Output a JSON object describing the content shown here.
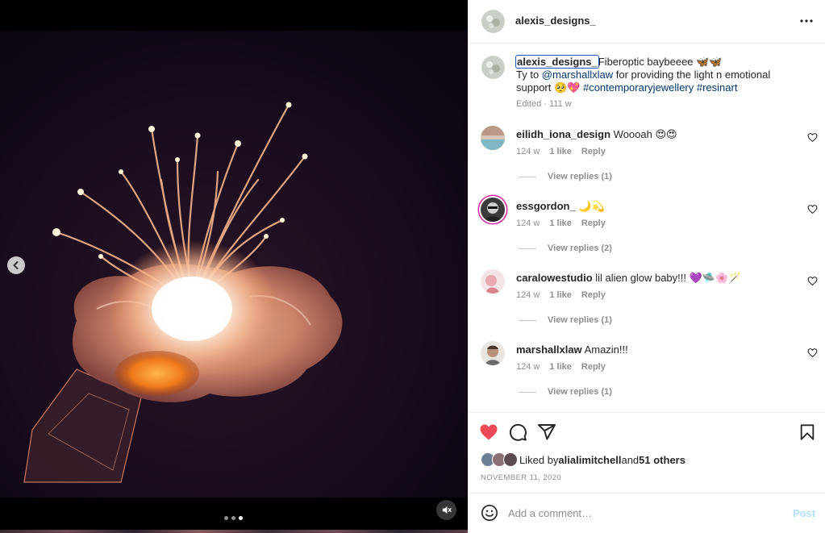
{
  "post": {
    "author": "alexis_designs_",
    "more_icon": "more-horizontal-icon",
    "caption": {
      "author": "alexis_designs_",
      "text_start": "Fiberoptic baybeeee 🦋🦋",
      "text_ty": "Ty to ",
      "mention": "@marshallxlaw",
      "text_mid": " for providing the light n emotional support 🥺💖 ",
      "hashtag1": "#contemporaryjewellery",
      "hashtag2": "#resinart",
      "meta": "Edited · 111 w"
    },
    "comments": [
      {
        "user": "eilidh_iona_design",
        "text": "Woooah 😍😍",
        "age": "124 w",
        "likes": "1 like",
        "reply": "Reply",
        "view_replies": "View replies (1)"
      },
      {
        "user": "essgordon_",
        "text": "🌙💫",
        "age": "124 w",
        "likes": "1 like",
        "reply": "Reply",
        "view_replies": "View replies (2)"
      },
      {
        "user": "caralowestudio",
        "text": "lil alien glow baby!!! 💜🛸🌸🪄",
        "age": "124 w",
        "likes": "1 like",
        "reply": "Reply",
        "view_replies": "View replies (1)"
      },
      {
        "user": "marshallxlaw",
        "text": "Amazin!!!",
        "age": "124 w",
        "likes": "1 like",
        "reply": "Reply",
        "view_replies": "View replies (1)"
      }
    ],
    "liked_by": {
      "prefix": "Liked by ",
      "user": "alialimitchell",
      "and": " and ",
      "others": "51 others"
    },
    "date": "NOVEMBER 11, 2020",
    "add_comment": {
      "placeholder": "Add a comment…",
      "post_label": "Post"
    },
    "media": {
      "slide_count": 3,
      "active_slide": 3
    },
    "colors": {
      "heart": "#ed4956",
      "link": "#00376b",
      "muted": "#8e8e8e",
      "post_disabled": "#b2dffc"
    }
  }
}
